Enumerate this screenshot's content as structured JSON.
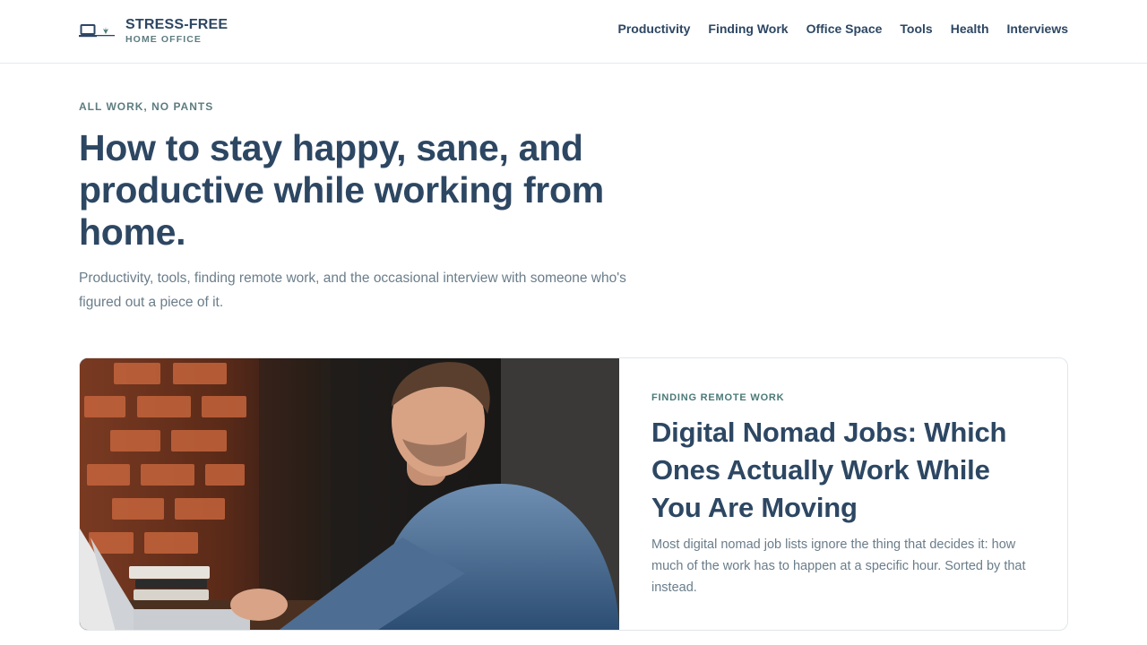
{
  "site": {
    "title": "STRESS-FREE",
    "subtitle": "HOME OFFICE"
  },
  "nav": {
    "items": [
      "Productivity",
      "Finding Work",
      "Office Space",
      "Tools",
      "Health",
      "Interviews"
    ]
  },
  "hero": {
    "kicker": "ALL WORK, NO PANTS",
    "headline": "How to stay happy, sane, and productive while working from home.",
    "lede": "Productivity, tools, finding remote work, and the occasional interview with someone who's figured out a piece of it."
  },
  "featured": {
    "tag": "FINDING REMOTE WORK",
    "title": "Digital Nomad Jobs: Which Ones Actually Work While You Are Moving",
    "summary": "Most digital nomad job lists ignore the thing that decides it: how much of the work has to happen at a specific hour. Sorted by that instead."
  },
  "colors": {
    "text_dark": "#2d4763",
    "text_muted": "#6a7d8a",
    "accent_teal": "#4a7a78",
    "border": "#e2e6ea"
  },
  "icons": {
    "logo": "laptop-plant-icon"
  }
}
